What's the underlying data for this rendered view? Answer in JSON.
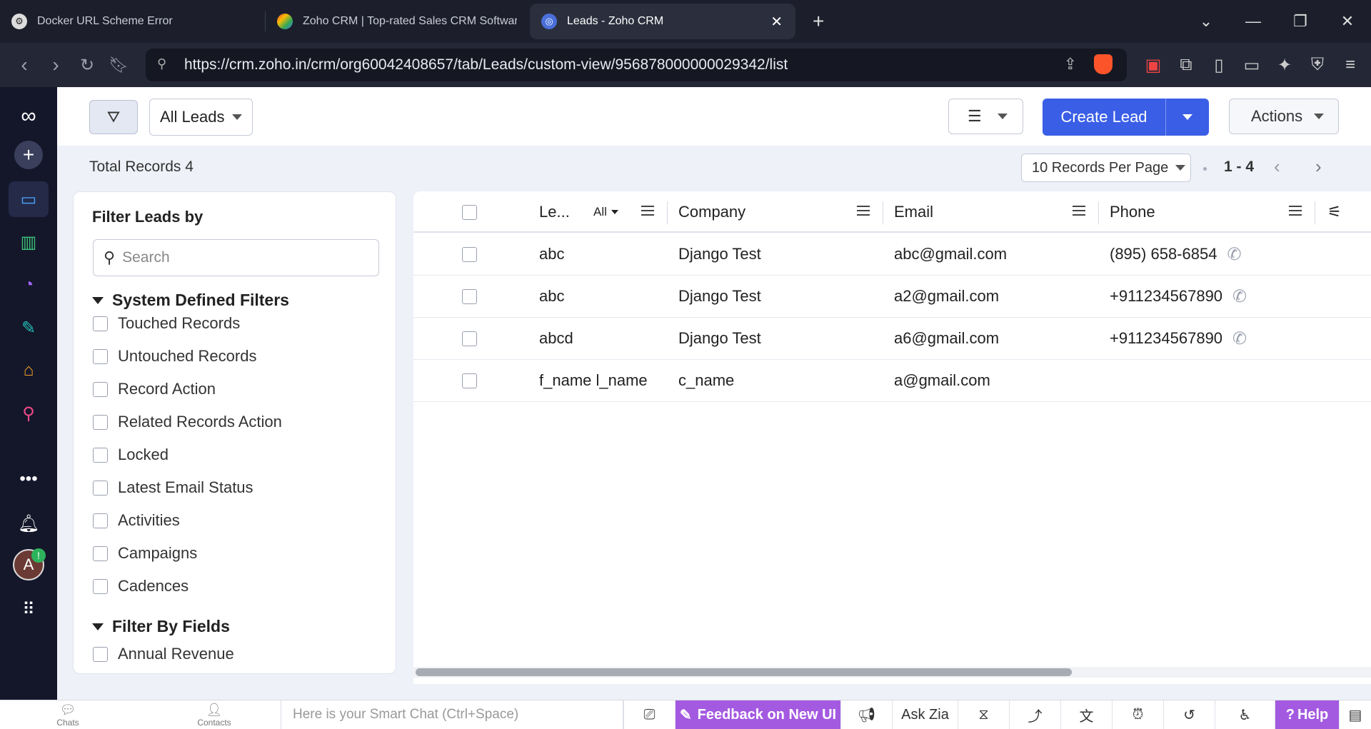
{
  "browser": {
    "tabs": [
      {
        "title": "Docker URL Scheme Error"
      },
      {
        "title": "Zoho CRM | Top-rated Sales CRM Software b"
      },
      {
        "title": "Leads - Zoho CRM"
      }
    ],
    "new_tab": "+",
    "close_tab": "✕",
    "url": "https://crm.zoho.in/crm/org60042408657/tab/Leads/custom-view/956878000000029342/list"
  },
  "toolbar": {
    "view_select": "All Leads",
    "create_label": "Create Lead",
    "actions_label": "Actions"
  },
  "summary": {
    "total_records": "Total Records 4",
    "per_page": "10 Records Per Page",
    "range": "1 - 4"
  },
  "filters": {
    "title": "Filter Leads by",
    "search_placeholder": "Search",
    "group_system": "System Defined Filters",
    "system_items": [
      "Touched Records",
      "Untouched Records",
      "Record Action",
      "Related Records Action",
      "Locked",
      "Latest Email Status",
      "Activities",
      "Campaigns",
      "Cadences"
    ],
    "group_fields": "Filter By Fields",
    "field_items": [
      "Annual Revenue"
    ]
  },
  "table": {
    "headers": {
      "lead": "Le...",
      "lead_filter": "All",
      "company": "Company",
      "email": "Email",
      "phone": "Phone"
    },
    "rows": [
      {
        "lead": "abc",
        "company": "Django Test",
        "email": "abc@gmail.com",
        "phone": "(895) 658-6854"
      },
      {
        "lead": "abc",
        "company": "Django Test",
        "email": "a2@gmail.com",
        "phone": "+911234567890"
      },
      {
        "lead": "abcd",
        "company": "Django Test",
        "email": "a6@gmail.com",
        "phone": "+911234567890"
      },
      {
        "lead": "f_name l_name",
        "company": "c_name",
        "email": "a@gmail.com",
        "phone": ""
      }
    ]
  },
  "bottom": {
    "chats": "Chats",
    "contacts": "Contacts",
    "smart_chat_placeholder": "Here is your Smart Chat (Ctrl+Space)",
    "feedback": "Feedback on New UI",
    "ask_zia": "Ask Zia",
    "help": "Help"
  },
  "colors": {
    "primary": "#3a5ee6",
    "rail": "#14172a",
    "feedback": "#a45ae0"
  }
}
